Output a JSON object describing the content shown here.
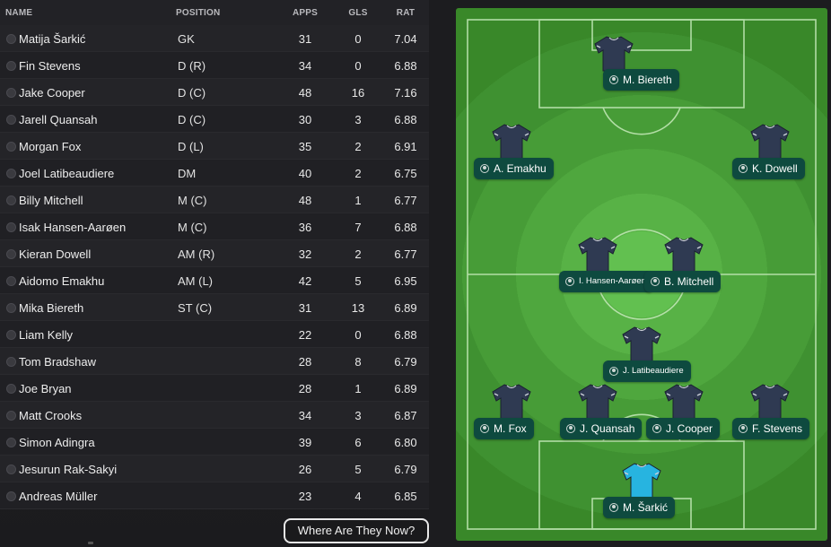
{
  "table": {
    "headers": {
      "name": "NAME",
      "position": "POSITION",
      "apps": "APPS",
      "gls": "GLS",
      "rat": "RAT"
    },
    "rows": [
      {
        "name": "Matija Šarkić",
        "position": "GK",
        "apps": "31",
        "gls": "0",
        "rat": "7.04"
      },
      {
        "name": "Fin Stevens",
        "position": "D (R)",
        "apps": "34",
        "gls": "0",
        "rat": "6.88"
      },
      {
        "name": "Jake Cooper",
        "position": "D (C)",
        "apps": "48",
        "gls": "16",
        "rat": "7.16"
      },
      {
        "name": "Jarell Quansah",
        "position": "D (C)",
        "apps": "30",
        "gls": "3",
        "rat": "6.88"
      },
      {
        "name": "Morgan Fox",
        "position": "D (L)",
        "apps": "35",
        "gls": "2",
        "rat": "6.91"
      },
      {
        "name": "Joel Latibeaudiere",
        "position": "DM",
        "apps": "40",
        "gls": "2",
        "rat": "6.75"
      },
      {
        "name": "Billy Mitchell",
        "position": "M (C)",
        "apps": "48",
        "gls": "1",
        "rat": "6.77"
      },
      {
        "name": "Isak Hansen-Aarøen",
        "position": "M (C)",
        "apps": "36",
        "gls": "7",
        "rat": "6.88"
      },
      {
        "name": "Kieran Dowell",
        "position": "AM (R)",
        "apps": "32",
        "gls": "2",
        "rat": "6.77"
      },
      {
        "name": "Aidomo Emakhu",
        "position": "AM (L)",
        "apps": "42",
        "gls": "5",
        "rat": "6.95"
      },
      {
        "name": "Mika Biereth",
        "position": "ST (C)",
        "apps": "31",
        "gls": "13",
        "rat": "6.89"
      },
      {
        "name": "Liam Kelly",
        "position": "",
        "apps": "22",
        "gls": "0",
        "rat": "6.88"
      },
      {
        "name": "Tom Bradshaw",
        "position": "",
        "apps": "28",
        "gls": "8",
        "rat": "6.79"
      },
      {
        "name": "Joe Bryan",
        "position": "",
        "apps": "28",
        "gls": "1",
        "rat": "6.89"
      },
      {
        "name": "Matt Crooks",
        "position": "",
        "apps": "34",
        "gls": "3",
        "rat": "6.87"
      },
      {
        "name": "Simon Adingra",
        "position": "",
        "apps": "39",
        "gls": "6",
        "rat": "6.80"
      },
      {
        "name": "Jesurun Rak-Sakyi",
        "position": "",
        "apps": "26",
        "gls": "5",
        "rat": "6.79"
      },
      {
        "name": "Andreas Müller",
        "position": "",
        "apps": "23",
        "gls": "4",
        "rat": "6.85"
      }
    ]
  },
  "button": {
    "label": "Where Are They Now?"
  },
  "pitch": {
    "players": [
      {
        "label": "M. Biereth",
        "kit": "outfield"
      },
      {
        "label": "A. Emakhu",
        "kit": "outfield"
      },
      {
        "label": "K. Dowell",
        "kit": "outfield"
      },
      {
        "label": "I. Hansen-Aarøen",
        "kit": "outfield"
      },
      {
        "label": "B. Mitchell",
        "kit": "outfield"
      },
      {
        "label": "J. Latibeaudiere",
        "kit": "outfield"
      },
      {
        "label": "M. Fox",
        "kit": "outfield"
      },
      {
        "label": "J. Quansah",
        "kit": "outfield"
      },
      {
        "label": "J. Cooper",
        "kit": "outfield"
      },
      {
        "label": "F. Stevens",
        "kit": "outfield"
      },
      {
        "label": "M. Šarkić",
        "kit": "goalkeeper"
      }
    ]
  },
  "colors": {
    "outfield_kit": "#2f3a52",
    "goalkeeper_kit": "#27b4e0",
    "label_bg": "#0e4a3f"
  }
}
